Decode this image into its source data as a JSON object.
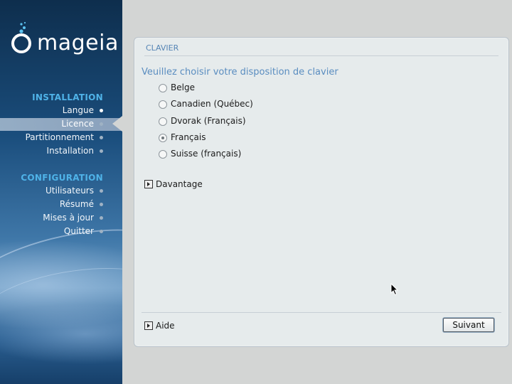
{
  "brand": {
    "logo_text": "mageia"
  },
  "sidebar": {
    "sections": [
      {
        "title": "INSTALLATION",
        "items": [
          {
            "label": "Langue",
            "state": "done"
          },
          {
            "label": "Licence",
            "state": "current"
          },
          {
            "label": "Partitionnement",
            "state": "pending"
          },
          {
            "label": "Installation",
            "state": "pending"
          }
        ]
      },
      {
        "title": "CONFIGURATION",
        "items": [
          {
            "label": "Utilisateurs",
            "state": "pending"
          },
          {
            "label": "Résumé",
            "state": "pending"
          },
          {
            "label": "Mises à jour",
            "state": "pending"
          },
          {
            "label": "Quitter",
            "state": "pending"
          }
        ]
      }
    ]
  },
  "panel": {
    "title": "CLAVIER",
    "prompt": "Veuillez choisir votre disposition de clavier",
    "options": [
      {
        "label": "Belge",
        "selected": false
      },
      {
        "label": "Canadien (Québec)",
        "selected": false
      },
      {
        "label": "Dvorak (Français)",
        "selected": false
      },
      {
        "label": "Français",
        "selected": true
      },
      {
        "label": "Suisse (français)",
        "selected": false
      }
    ],
    "more_label": "Davantage",
    "help_label": "Aide",
    "next_label": "Suivant"
  },
  "colors": {
    "accent": "#4fb3e8",
    "prompt": "#5a8dc0",
    "panel_bg": "#e6ebec"
  }
}
